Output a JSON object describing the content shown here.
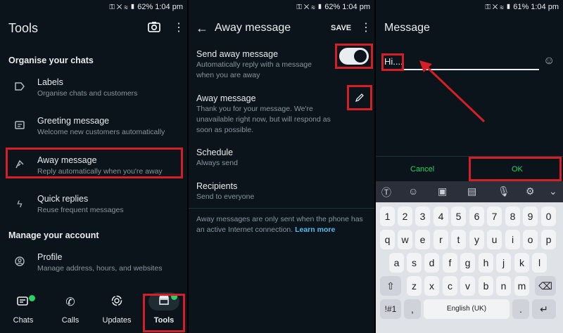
{
  "status_left": {
    "battery": "62%",
    "time": "1:04 pm"
  },
  "status_right": {
    "battery": "61%",
    "time": "1:04 pm"
  },
  "tools": {
    "title": "Tools",
    "section1": "Organise your chats",
    "items": [
      {
        "title": "Labels",
        "subtitle": "Organise chats and customers",
        "icon": "label-icon"
      },
      {
        "title": "Greeting message",
        "subtitle": "Welcome new customers automatically",
        "icon": "greeting-icon"
      },
      {
        "title": "Away message",
        "subtitle": "Reply automatically when you're away",
        "icon": "away-icon"
      },
      {
        "title": "Quick replies",
        "subtitle": "Reuse frequent messages",
        "icon": "bolt-icon"
      }
    ],
    "section2": "Manage your account",
    "profile": {
      "title": "Profile",
      "subtitle": "Manage address, hours, and websites"
    },
    "nav": [
      "Chats",
      "Calls",
      "Updates",
      "Tools"
    ]
  },
  "away": {
    "title": "Away message",
    "save": "SAVE",
    "send_title": "Send away message",
    "send_sub": "Automatically reply with a message when you are away",
    "msg_title": "Away message",
    "msg_sub": "Thank you for your message. We're unavailable right now, but will respond as soon as possible.",
    "schedule_title": "Schedule",
    "schedule_sub": "Always send",
    "recipients_title": "Recipients",
    "recipients_sub": "Send to everyone",
    "footer_text": "Away messages are only sent when the phone has an active Internet connection.",
    "footer_link": "Learn more"
  },
  "message": {
    "title": "Message",
    "input": "Hi....",
    "cancel": "Cancel",
    "ok": "OK",
    "space_label": "English (UK)",
    "rows": [
      [
        "1",
        "2",
        "3",
        "4",
        "5",
        "6",
        "7",
        "8",
        "9",
        "0"
      ],
      [
        "q",
        "w",
        "e",
        "r",
        "t",
        "y",
        "u",
        "i",
        "o",
        "p"
      ],
      [
        "a",
        "s",
        "d",
        "f",
        "g",
        "h",
        "j",
        "k",
        "l"
      ],
      [
        "z",
        "x",
        "c",
        "v",
        "b",
        "n",
        "m"
      ]
    ],
    "sym": "!#1",
    "comma": ",",
    "period": "."
  },
  "colors": {
    "accent": "#25d366",
    "highlight": "#d51f26",
    "bg": "#0b141a"
  }
}
